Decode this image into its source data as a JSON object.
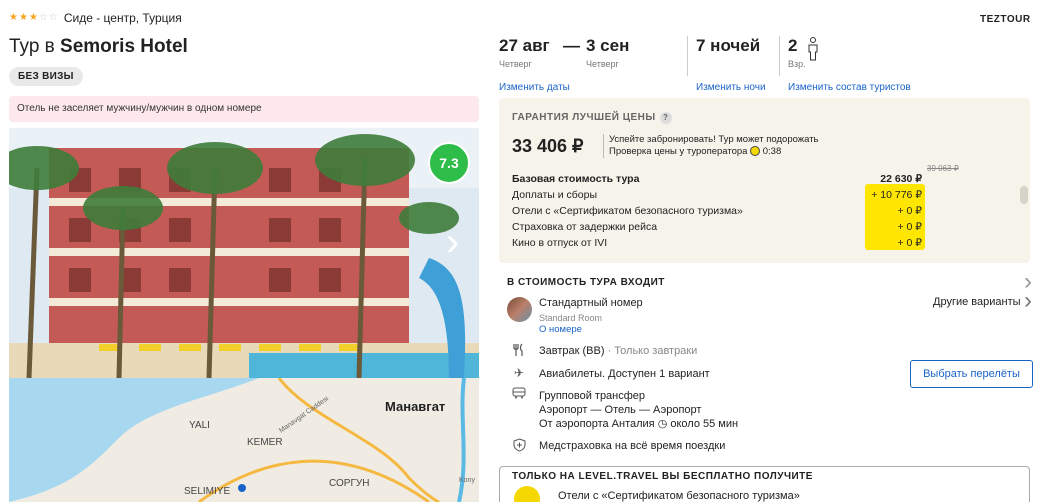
{
  "hotel": {
    "stars_filled": 3,
    "stars_total": 5,
    "location": "Сиде - центр, Турция",
    "title_prefix": "Тур в ",
    "name": "Semoris Hotel",
    "visa_badge": "БЕЗ ВИЗЫ",
    "warning": "Отель не заселяет мужчину/мужчин в одном номере",
    "rating": "7.3"
  },
  "map": {
    "labels": [
      "Манавгат",
      "YALI",
      "KEMER",
      "SELIMIYE",
      "СОРГУН",
      "Manavgat Caddesi",
      "Kony"
    ]
  },
  "operator": "TEZTOUR",
  "trip": {
    "date_from": "27 авг",
    "dash": "—",
    "date_to": "3 сен",
    "day_from": "Четверг",
    "day_to": "Четверг",
    "change_dates": "Изменить даты",
    "nights": "7 ночей",
    "change_nights": "Изменить ночи",
    "tourists": "2",
    "tourists_sub": "Взр.",
    "change_tourists": "Изменить состав туристов"
  },
  "price_box": {
    "guarantee": "ГАРАНТИЯ ЛУЧШЕЙ ЦЕНЫ",
    "help": "?",
    "price": "33 406 ₽",
    "note1": "Успейте забронировать! Тур может подорожать",
    "note2": "Проверка цены у туроператора",
    "timer": "0:38",
    "old_price": "39 063 ₽",
    "rows": [
      {
        "label": "Базовая стоимость тура",
        "value": "22 630 ₽",
        "bold": true
      },
      {
        "label": "Доплаты и сборы",
        "value": "+ 10 776 ₽"
      },
      {
        "label": "Отели с «Сертификатом безопасного туризма»",
        "value": "+ 0 ₽"
      },
      {
        "label": "Страховка от задержки рейса",
        "value": "+ 0 ₽"
      },
      {
        "label": "Кино в отпуск от IVI",
        "value": "+ 0 ₽"
      }
    ]
  },
  "included": {
    "title": "В СТОИМОСТЬ ТУРА ВХОДИТ",
    "room_name": "Стандартный номер",
    "room_en": "Standard Room",
    "room_link": "О номере",
    "other_variants": "Другие варианты",
    "meal": "Завтрак (BB)",
    "meal_note": " · Только завтраки",
    "flight": "Авиабилеты. Доступен 1 вариант",
    "choose_flights": "Выбрать перелёты",
    "transfer_title": "Групповой трансфер",
    "transfer_route": "Аэропорт — Отель — Аэропорт",
    "transfer_from": "От аэропорта Анталия",
    "transfer_time": "около 55 мин",
    "insurance": "Медстраховка на всё время поездки"
  },
  "level_travel": {
    "title": "ТОЛЬКО НА LEVEL.TRAVEL ВЫ БЕСПЛАТНО ПОЛУЧИТЕ",
    "item": "Отели с «Сертификатом безопасного туризма»"
  }
}
